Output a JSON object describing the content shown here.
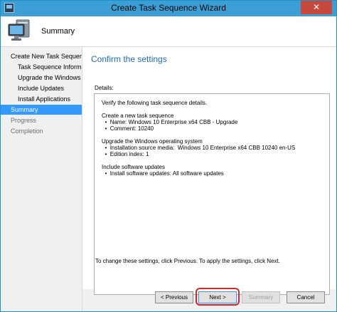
{
  "window": {
    "title": "Create Task Sequence Wizard",
    "close_glyph": "✕",
    "accent_color": "#3b9fd6"
  },
  "header": {
    "icon": "computer-icon",
    "title": "Summary"
  },
  "sidebar": {
    "items": [
      {
        "label": "Create New Task Sequence",
        "state": "normal"
      },
      {
        "label": "Task Sequence Informati",
        "state": "normal"
      },
      {
        "label": "Upgrade the Windows Op",
        "state": "normal"
      },
      {
        "label": "Include Updates",
        "state": "normal"
      },
      {
        "label": "Install Applications",
        "state": "normal"
      },
      {
        "label": "Summary",
        "state": "selected"
      },
      {
        "label": "Progress",
        "state": "dim"
      },
      {
        "label": "Completion",
        "state": "dim"
      }
    ]
  },
  "main": {
    "heading": "Confirm the settings",
    "details_label": "Details:",
    "details_text": "Verify the following task sequence details.\n\nCreate a new task sequence\n  •  Name: Windows 10 Enterprise x64 CBB - Upgrade\n  •  Comment: 10240\n\nUpgrade the Windows operating system\n  •  Installation source media:  Windows 10 Enterprise x64 CBB 10240 en-US\n  •  Edition index: 1\n\nInclude software updates\n  •  Install software updates: All software updates",
    "footer_note": "To change these settings, click Previous. To apply the settings, click Next."
  },
  "buttons": {
    "previous": "< Previous",
    "next": "Next >",
    "summary": "Summary",
    "cancel": "Cancel"
  }
}
